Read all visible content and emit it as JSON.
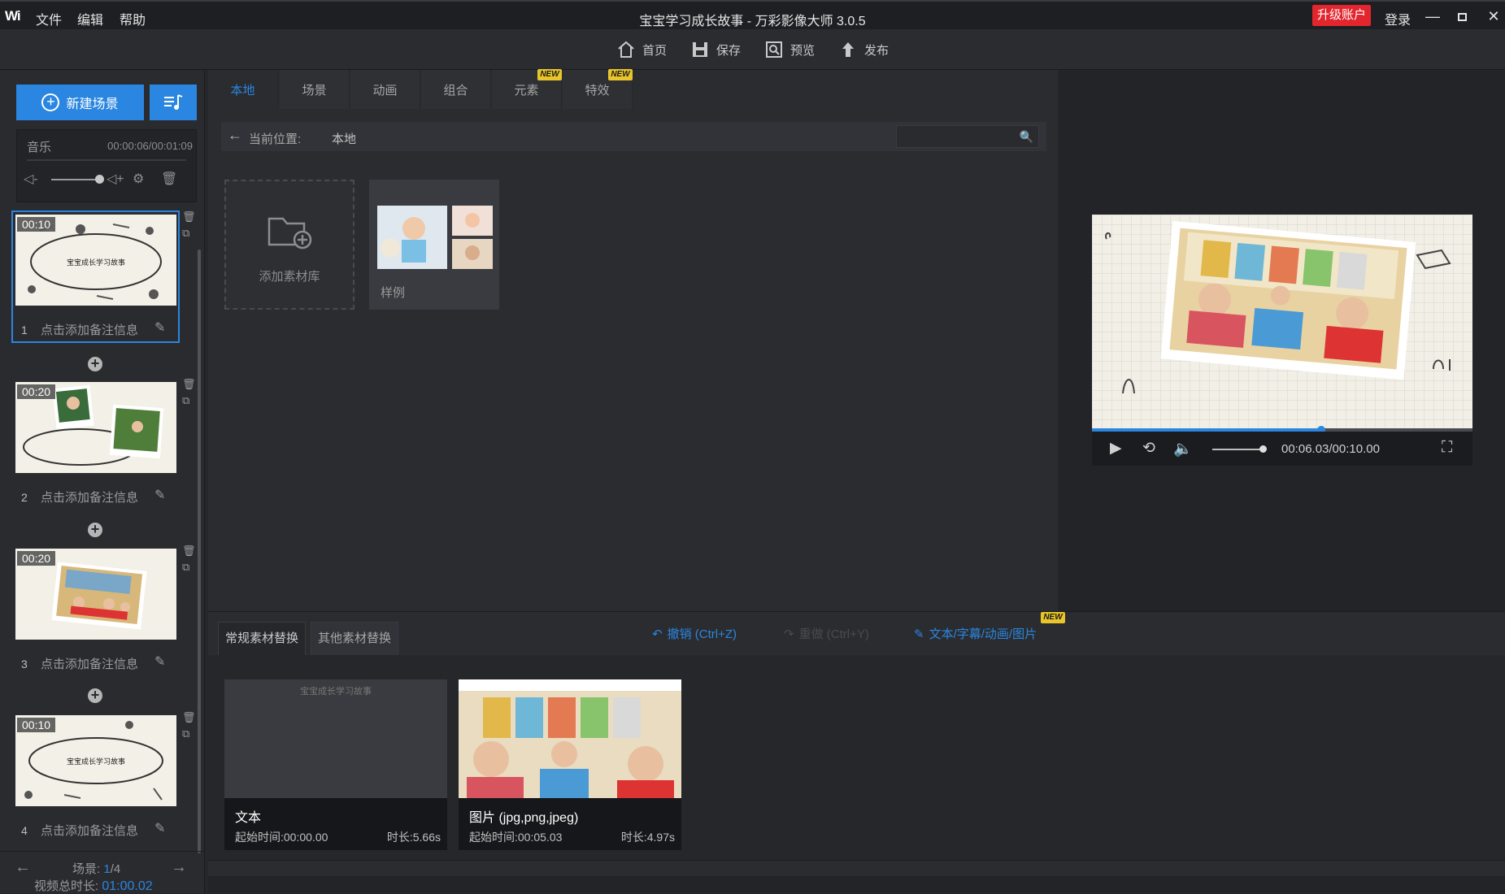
{
  "app": {
    "logo": "Wi",
    "title": "宝宝学习成长故事 - 万彩影像大师 3.0.5",
    "menu": [
      "文件",
      "编辑",
      "帮助"
    ],
    "upgrade": "升级账户",
    "login": "登录"
  },
  "toolbar": {
    "home": "首页",
    "save": "保存",
    "preview": "预览",
    "publish": "发布"
  },
  "left": {
    "new_scene": "新建场景",
    "music_label": "音乐",
    "music_time": "00:00:06/00:01:09",
    "scenes": [
      {
        "num": "1",
        "dur": "00:10",
        "note": "点击添加备注信息"
      },
      {
        "num": "2",
        "dur": "00:20",
        "note": "点击添加备注信息"
      },
      {
        "num": "3",
        "dur": "00:20",
        "note": "点击添加备注信息"
      },
      {
        "num": "4",
        "dur": "00:10",
        "note": "点击添加备注信息"
      }
    ],
    "scene_label": "场景:",
    "scene_current": "1",
    "scene_total": "/4",
    "total_label": "视频总时长:",
    "total_value": "01:00.02"
  },
  "library": {
    "tabs": [
      "本地",
      "场景",
      "动画",
      "组合",
      "元素",
      "特效"
    ],
    "new_tag": "NEW",
    "path_label": "当前位置:",
    "path_value": "本地",
    "add_lib": "添加素材库",
    "sample": "样例"
  },
  "player": {
    "time": "00:06.03/00:10.00",
    "progress": 0.603,
    "volume": 0.85
  },
  "bottom": {
    "tab1": "常规素材替换",
    "tab2": "其他素材替换",
    "undo": "撤销 (Ctrl+Z)",
    "redo": "重做 (Ctrl+Y)",
    "text_edit": "文本/字幕/动画/图片",
    "cards": [
      {
        "title": "文本",
        "start": "起始时间:00:00.00",
        "duration": "时长:5.66s",
        "preview_text": "宝宝成长学习故事"
      },
      {
        "title": "图片 (jpg,png,jpeg)",
        "start": "起始时间:00:05.03",
        "duration": "时长:4.97s"
      }
    ]
  },
  "colors": {
    "accent": "#2a86e0",
    "upgrade_red": "#e3262e",
    "new_yellow": "#e8c52a"
  }
}
